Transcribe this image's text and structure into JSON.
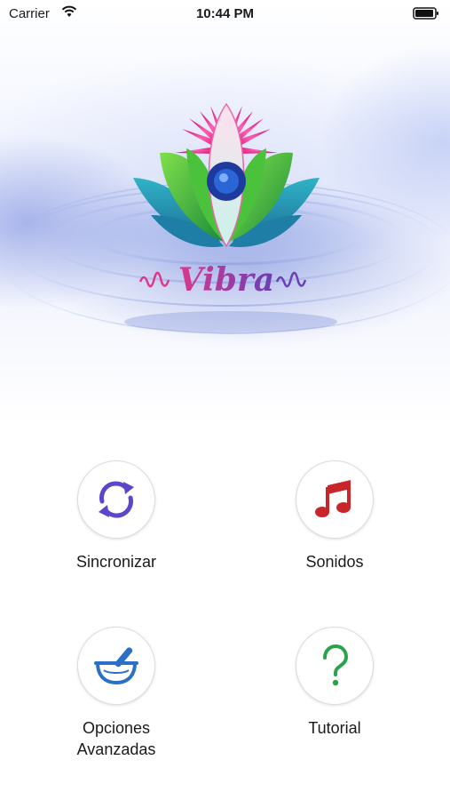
{
  "status_bar": {
    "carrier": "Carrier",
    "time": "10:44 PM"
  },
  "logo": {
    "text": "Vibra"
  },
  "menu": [
    {
      "label": "Sincronizar",
      "icon": "sync-icon",
      "color": "#5b47c9"
    },
    {
      "label": "Sonidos",
      "icon": "music-note-icon",
      "color": "#c8262a"
    },
    {
      "label": "Opciones\nAvanzadas",
      "icon": "mortar-pestle-icon",
      "color": "#2b6fc7"
    },
    {
      "label": "Tutorial",
      "icon": "question-mark-icon",
      "color": "#2aa34a"
    }
  ]
}
